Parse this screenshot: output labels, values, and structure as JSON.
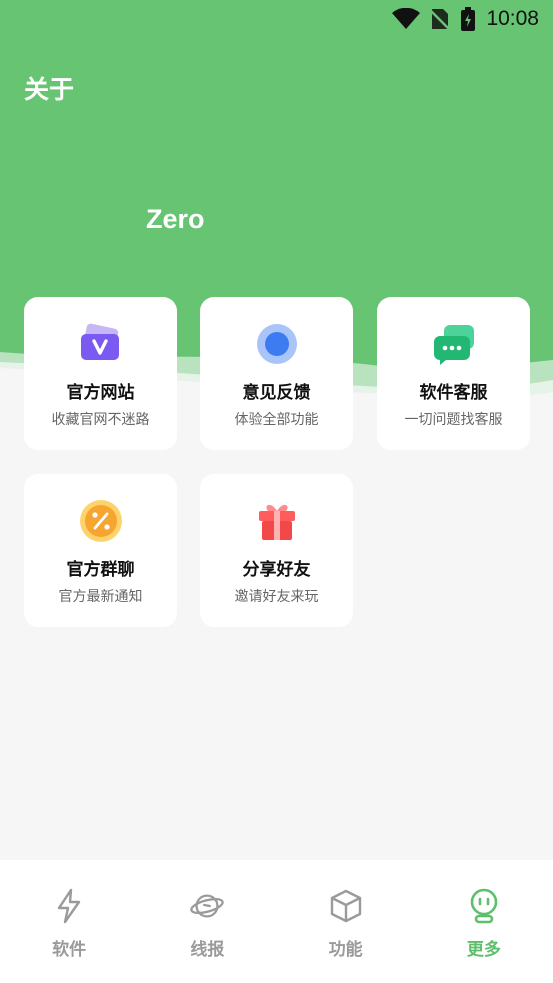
{
  "status_bar": {
    "time": "10:08"
  },
  "header": {
    "title": "关于",
    "app_name": "Zero",
    "color": "#66c472"
  },
  "cards": [
    {
      "title": "官方网站",
      "subtitle": "收藏官网不迷路",
      "icon": "website-icon"
    },
    {
      "title": "意见反馈",
      "subtitle": "体验全部功能",
      "icon": "feedback-icon"
    },
    {
      "title": "软件客服",
      "subtitle": "一切问题找客服",
      "icon": "chat-icon"
    },
    {
      "title": "官方群聊",
      "subtitle": "官方最新通知",
      "icon": "percent-icon"
    },
    {
      "title": "分享好友",
      "subtitle": "邀请好友来玩",
      "icon": "gift-icon"
    }
  ],
  "tabs": [
    {
      "label": "软件",
      "icon": "lightning-icon",
      "active": false
    },
    {
      "label": "线报",
      "icon": "planet-icon",
      "active": false
    },
    {
      "label": "功能",
      "icon": "cube-icon",
      "active": false
    },
    {
      "label": "更多",
      "icon": "robot-icon",
      "active": true
    }
  ],
  "colors": {
    "accent": "#5cbf6c",
    "inactive": "#9a9a9a"
  }
}
